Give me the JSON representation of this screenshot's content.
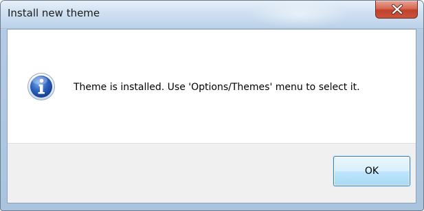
{
  "window": {
    "title": "Install new theme",
    "close_icon": "close-icon"
  },
  "message": {
    "icon": "information-icon",
    "text": "Theme is installed. Use 'Options/Themes' menu to select it."
  },
  "buttons": {
    "ok_label": "OK"
  },
  "colors": {
    "close_button": "#c2412b",
    "icon_blue": "#1e50a8",
    "button_border": "#3c7fb1"
  }
}
